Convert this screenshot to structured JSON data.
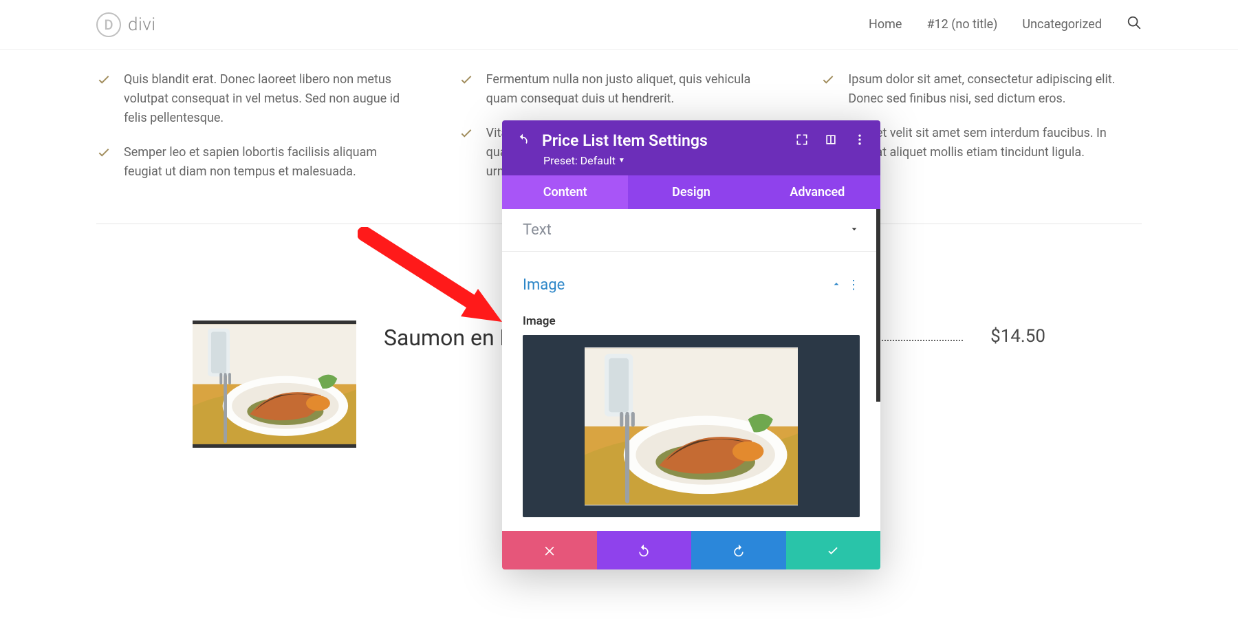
{
  "header": {
    "logo_letter": "D",
    "logo_text": "divi",
    "nav": {
      "home": "Home",
      "item2": "#12 (no title)",
      "item3": "Uncategorized"
    }
  },
  "blurbs": {
    "c1a": "Quis blandit erat. Donec laoreet libero non metus volutpat consequat in vel metus. Sed non augue id felis pellentesque.",
    "c1b": "Semper leo et sapien lobortis facilisis aliquam feugiat ut diam non tempus et malesuada.",
    "c2a": "Fermentum nulla non justo aliquet, quis vehicula quam consequat duis ut hendrerit.",
    "c2b": "Vita\nqua\nurn",
    "c3a": "Ipsum dolor sit amet, consectetur adipiscing elit. Donec sed finibus nisi, sed dictum eros.",
    "c3b": "Aliquet velit sit amet sem interdum faucibus. In feugiat aliquet mollis etiam tincidunt ligula."
  },
  "price_item": {
    "title": "Saumon en Papil",
    "price": "$14.50"
  },
  "modal": {
    "title": "Price List Item Settings",
    "preset": "Preset: Default",
    "tabs": {
      "content": "Content",
      "design": "Design",
      "advanced": "Advanced"
    },
    "sections": {
      "text": "Text",
      "image": "Image"
    },
    "field_image": "Image"
  }
}
